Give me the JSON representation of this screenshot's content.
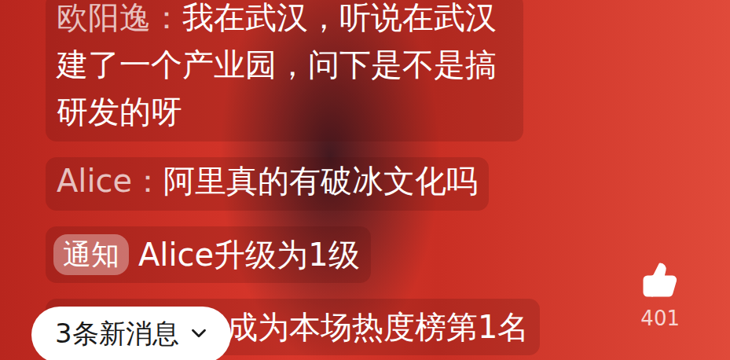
{
  "chat": {
    "messages": [
      {
        "kind": "message",
        "user": "欧阳逸：",
        "text": "我在武汉，听说在武汉建了一个产业园，问下是不是搞研发的呀"
      },
      {
        "kind": "message",
        "user": "Alice：",
        "text": "阿里真的有破冰文化吗"
      },
      {
        "kind": "notice",
        "badge": "通知",
        "text": "Alice升级为1级"
      },
      {
        "kind": "system",
        "text": "成为本场热度榜第1名"
      }
    ]
  },
  "new_messages": {
    "label": "3条新消息"
  },
  "likes": {
    "count": "401"
  }
}
